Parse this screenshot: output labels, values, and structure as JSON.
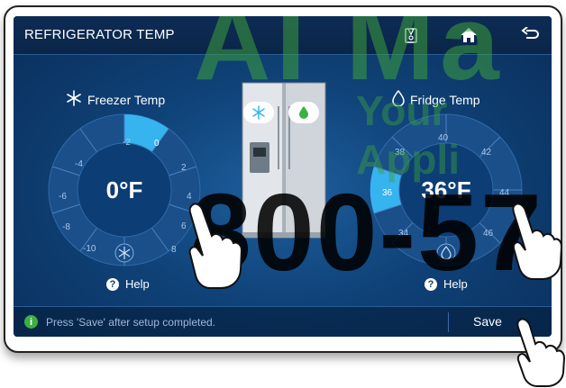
{
  "header": {
    "title": "REFRIGERATOR TEMP",
    "icons": [
      "fridge-status-icon",
      "home-icon",
      "back-icon"
    ]
  },
  "freezer": {
    "title": "Freezer Temp",
    "value": "0°F",
    "ticks": [
      "-2",
      "0",
      "2",
      "4",
      "6",
      "8",
      "-10",
      "-8",
      "-6",
      "-4"
    ],
    "selected": "0",
    "help": "Help"
  },
  "fridge": {
    "title": "Fridge Temp",
    "value": "36°F",
    "ticks": [
      "40",
      "42",
      "44",
      "46",
      "34",
      "36",
      "38"
    ],
    "selected": "36",
    "help": "Help"
  },
  "footer": {
    "message": "Press  'Save'  after setup completed.",
    "save_label": "Save"
  },
  "watermark": {
    "line1": "AI Ma",
    "line2": "Your Appli",
    "line3": "800-57"
  },
  "colors": {
    "accent": "#36b4f0",
    "background": "#0f4278",
    "info": "#3cb043"
  }
}
